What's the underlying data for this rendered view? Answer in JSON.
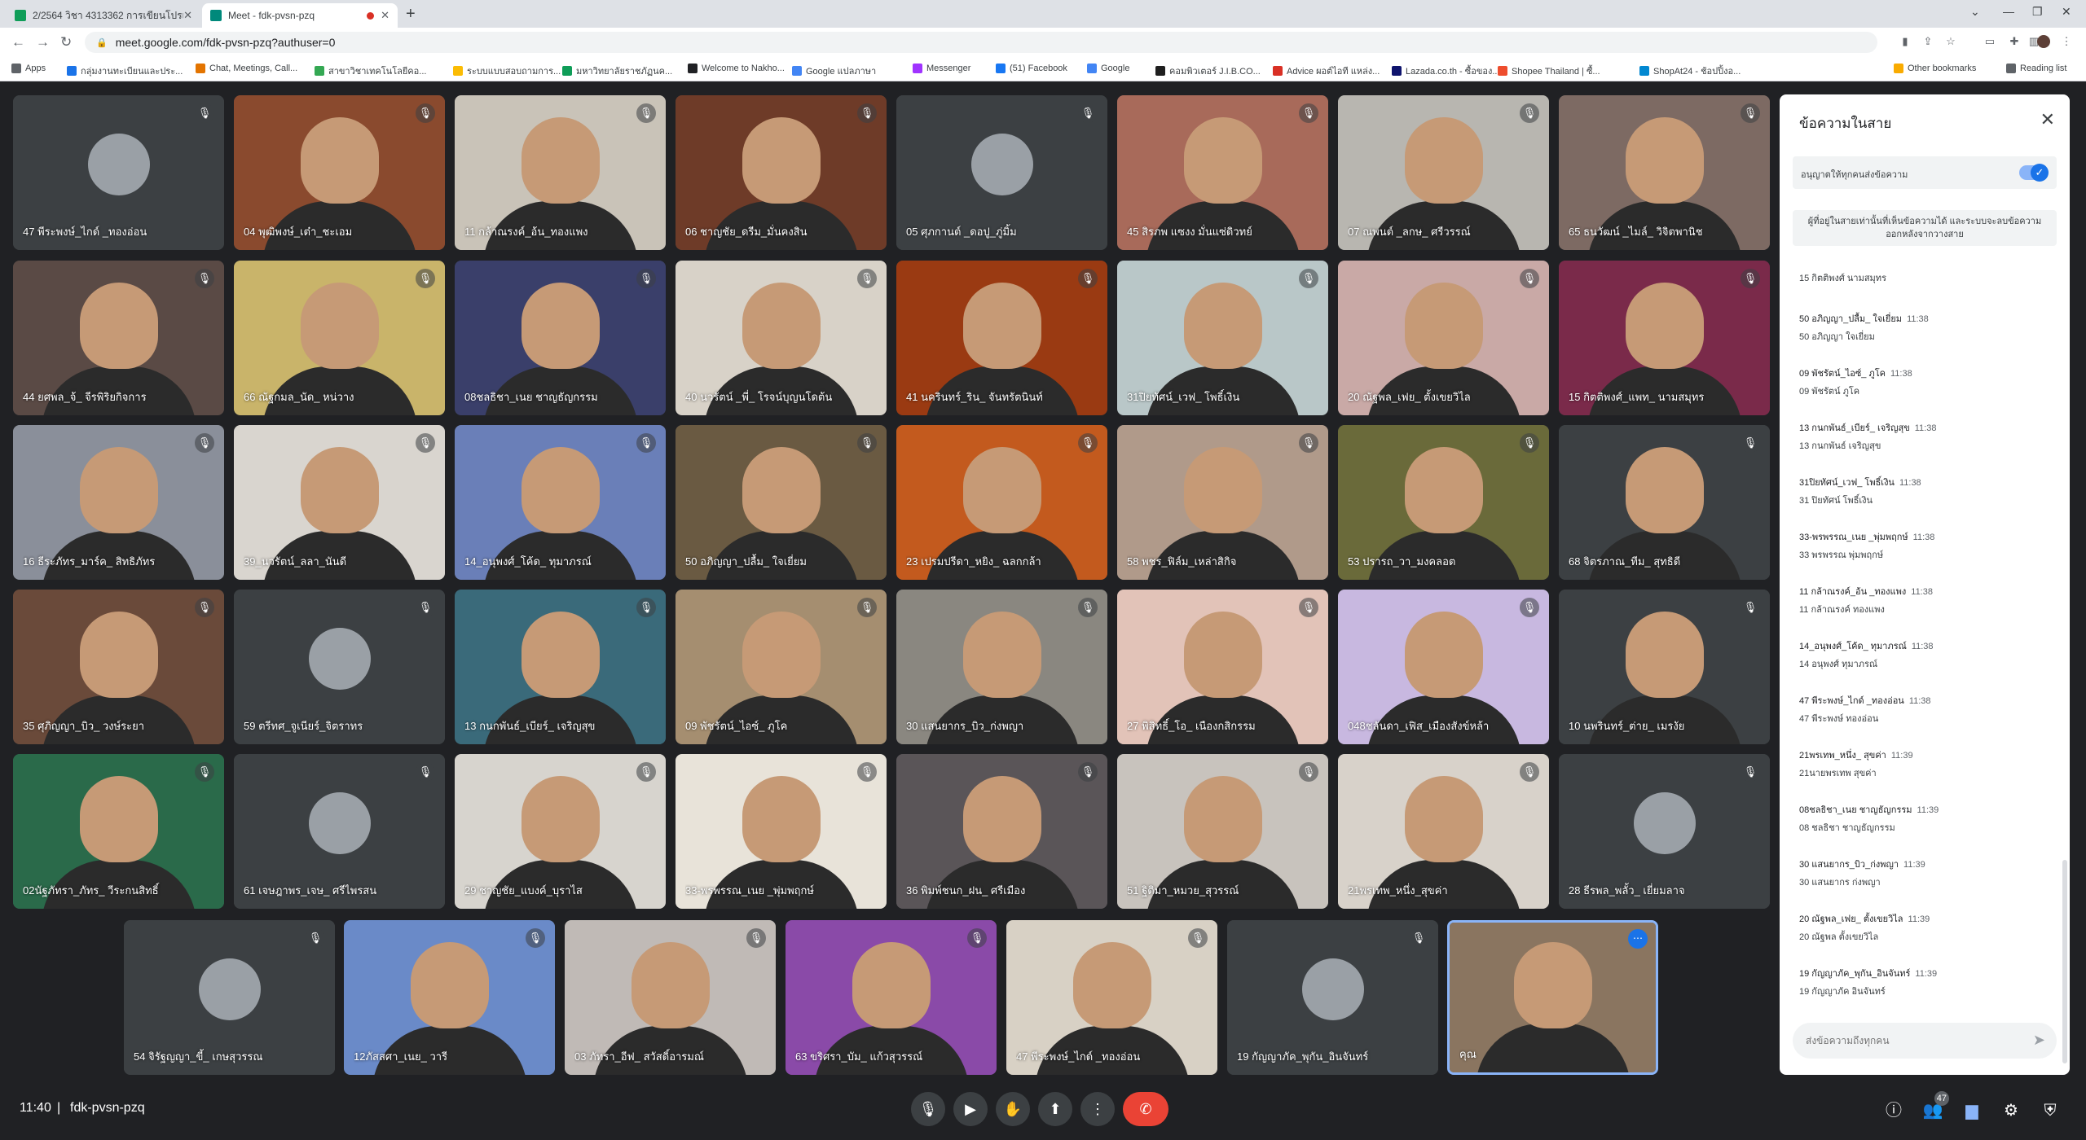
{
  "browser": {
    "tabs": [
      {
        "title": "2/2564 วิชา 4313362 การเขียนโปรแ",
        "favicon_color": "#0f9d58"
      },
      {
        "title": "Meet - fdk-pvsn-pzq",
        "favicon_color": "#00897b"
      }
    ],
    "url": "meet.google.com/fdk-pvsn-pzq?authuser=0",
    "bookmarks": [
      {
        "label": "Apps",
        "color": "#5f6368"
      },
      {
        "label": "กลุ่มงานทะเบียนและประ...",
        "color": "#1a73e8"
      },
      {
        "label": "Chat, Meetings, Call...",
        "color": "#e37400"
      },
      {
        "label": "สาขาวิชาเทคโนโลยีคอ...",
        "color": "#34a853"
      },
      {
        "label": "ระบบแบบสอบถามการ...",
        "color": "#fbbc04"
      },
      {
        "label": "มหาวิทยาลัยราชภัฏนค...",
        "color": "#0f9d58"
      },
      {
        "label": "Welcome to Nakho...",
        "color": "#202124"
      },
      {
        "label": "Google แปลภาษา",
        "color": "#4285f4"
      },
      {
        "label": "Messenger",
        "color": "#a033ff"
      },
      {
        "label": "(51) Facebook",
        "color": "#1877f2"
      },
      {
        "label": "Google",
        "color": "#4285f4"
      },
      {
        "label": "คอมพิวเตอร์ J.I.B.CO...",
        "color": "#1f1f1f"
      },
      {
        "label": "Advice ผอต์ไอที แหล่ง...",
        "color": "#d93025"
      },
      {
        "label": "Lazada.co.th - ซื้อของ...",
        "color": "#0f146d"
      },
      {
        "label": "Shopee Thailand | ซื้...",
        "color": "#ee4d2d"
      },
      {
        "label": "ShopAt24 - ช้อปปิ้งอ...",
        "color": "#0288d1"
      }
    ],
    "other_bookmarks": "Other bookmarks",
    "reading_list": "Reading list"
  },
  "participants": [
    {
      "name": "47 พีระพงษ์_ไกด์ _ทองอ่อน",
      "color": "#3c4043",
      "avatar": true
    },
    {
      "name": "04 พุฒิพงษ์_เต๋า_ชะเอม",
      "color": "#8a4a2e",
      "avatar": false
    },
    {
      "name": "11 กล้าณรงค์_อ้น_ทองแพง",
      "color": "#c9c3b8",
      "avatar": false
    },
    {
      "name": "06 ชาญชัย_ดรีม_มั่นคงสิน",
      "color": "#6e3b28",
      "avatar": false
    },
    {
      "name": "05 ศุภกานต์ _ดอปู_ภู่มิ้ม",
      "color": "#3c4043",
      "avatar": true
    },
    {
      "name": "45 สิรภพ แซงง มั่นแซ่ดิวทย์",
      "color": "#a86a5a",
      "avatar": false
    },
    {
      "name": "07 ณพนต์ _ลกษ_ ศรีวรรณ์",
      "color": "#b8b6b0",
      "avatar": false
    },
    {
      "name": "65 ธนวัฒน์ _ไมล์_ วิจิตพานิช",
      "color": "#7d6a63",
      "avatar": false
    },
    {
      "name": "44 ยศพล_จ้_ จีรพิริยกิจการ",
      "color": "#5a4a45",
      "avatar": false
    },
    {
      "name": "66 ณัฐกมล_นัด_ หน่วาง",
      "color": "#c9b46a",
      "avatar": false
    },
    {
      "name": "08ชลธิชา_เนย ชาญธัญกรรม",
      "color": "#3a3f6a",
      "avatar": false
    },
    {
      "name": "40 นวรัตน์ _พี่_ โรจน์บุญนโดต้น",
      "color": "#d8d2c8",
      "avatar": false
    },
    {
      "name": "41 นครินทร์_ริน_ จันทรัตนินท์",
      "color": "#9a3a12",
      "avatar": false
    },
    {
      "name": "31ปิยทัศน์_เวฟ_ โพธิ์เงิน",
      "color": "#b9c7c8",
      "avatar": false
    },
    {
      "name": "20 ณัฐพล_เฟย_ ตั้งเขยวิไล",
      "color": "#c9a9a6",
      "avatar": false
    },
    {
      "name": "15 กิตติพงศ์_แพท_ นามสมุทร",
      "color": "#7a2a4a",
      "avatar": false
    },
    {
      "name": "16 ธีระภัทร_มาร์ค_ สิทธิภัทร",
      "color": "#8a8f9a",
      "avatar": false
    },
    {
      "name": "39_นวรัตน์_ลลา_นันดี",
      "color": "#d9d5cf",
      "avatar": false
    },
    {
      "name": "14_อนุพงศ์_โค้ด_ ทุมาภรณ์",
      "color": "#6a7fb8",
      "avatar": false
    },
    {
      "name": "50 อภิญญา_ปลื้ม_ ใจเยี่ยม",
      "color": "#6a5a42",
      "avatar": false
    },
    {
      "name": "23 เปรมปรีดา_หยิง_ ฉลกกล้า",
      "color": "#c35a1e",
      "avatar": false
    },
    {
      "name": "58 พชร_ฟิล์ม_เหล่าสิกิจ",
      "color": "#b09a8a",
      "avatar": false
    },
    {
      "name": "53 ปรารถ_วา_มงคลอต",
      "color": "#6a6a3a",
      "avatar": false
    },
    {
      "name": "68 จิตรภาณ_ทีม_ สุทธิดี",
      "color": "#3c4043",
      "avatar": false
    },
    {
      "name": "35 ศุภิญญา_บิว_ วงษ์ระยา",
      "color": "#6a4a3a",
      "avatar": false
    },
    {
      "name": "59 ตรีทศ_จูเนียร์_จิตราทร",
      "color": "#3c4043",
      "avatar": true
    },
    {
      "name": "13 กนกพันธ์_เบียร์_ เจริญสุข",
      "color": "#3a6a7a",
      "avatar": false
    },
    {
      "name": "09 พัชรัตน์_ไอซ์_ ภูโค",
      "color": "#a58e70",
      "avatar": false
    },
    {
      "name": "30 แสนยากร_บิว_ก่งพญา",
      "color": "#8a8780",
      "avatar": false
    },
    {
      "name": "27 พิสิทธิ์_โอ_ เนืองกสิกรรม",
      "color": "#e2c3b8",
      "avatar": false
    },
    {
      "name": "048ชลันดา_เฟิส_เมืองสังข์หล้า",
      "color": "#c8b8e0",
      "avatar": false
    },
    {
      "name": "10 นพรินทร์_ต่าย_ เมรงัย",
      "color": "#3c4043",
      "avatar": false
    },
    {
      "name": "02นัฐภัทรา_ภัทร_ วีระกนสิทธิ์",
      "color": "#2a6a4a",
      "avatar": false
    },
    {
      "name": "61 เจษฎาพร_เจษ_ ศรีไพรสน",
      "color": "#3c4043",
      "avatar": true
    },
    {
      "name": "29 ชาญชัย_แบงค์_บุราไส",
      "color": "#d7d4ce",
      "avatar": false
    },
    {
      "name": "33-พรพรรณ_เนย _พุ่มพฤกษ์",
      "color": "#e8e3d9",
      "avatar": false
    },
    {
      "name": "36 พิมพ์ชนก_ฝน_ ศรีเมือง",
      "color": "#5a5558",
      "avatar": false
    },
    {
      "name": "51 ฐิติมา_หมวย_สุวรรณ์",
      "color": "#c8c3bd",
      "avatar": false
    },
    {
      "name": "21พรเทพ_หนึ่ง_สุขค่า",
      "color": "#d8d2ca",
      "avatar": false
    },
    {
      "name": "28 ธีรพล_พลั้ว_ เยี่ยมลาจ",
      "color": "#3c4043",
      "avatar": true
    },
    {
      "name": "54 จิรัฐญญา_ขี้_ เกษสุวรรณ",
      "color": "#3c4043",
      "avatar": true
    },
    {
      "name": "12ภัสสศา_เนย_ วารี",
      "color": "#6a8ac8",
      "avatar": false
    },
    {
      "name": "03 ภัทรา_อีฟ_ สวัสดิ์อารมณ์",
      "color": "#c0bab6",
      "avatar": false
    },
    {
      "name": "63 ขริศรา_บัม_ แก้วสุวรรณ์",
      "color": "#8a4aa8",
      "avatar": false
    },
    {
      "name": "47 พีระพงษ์_ไกด์ _ทองอ่อน",
      "color": "#d8d1c5",
      "avatar": false
    },
    {
      "name": "19 กัญญาภัค_พุกัน_อินจันทร์",
      "color": "#3c4043",
      "avatar": true
    },
    {
      "name": "คุณ",
      "color": "#8a7560",
      "avatar": false
    }
  ],
  "chat": {
    "title": "ข้อความในสาย",
    "allow_label": "อนุญาตให้ทุกคนส่งข้อความ",
    "notice": "ผู้ที่อยู่ในสายเท่านั้นที่เห็นข้อความได้ และระบบจะลบข้อความออกหลังจากวางสาย",
    "messages": [
      {
        "sender": "",
        "time": "",
        "text": "15 กิตติพงศ์ นามสมุทร"
      },
      {
        "sender": "50 อภิญญา_ปลื้ม_ ใจเยี่ยม",
        "time": "11:38",
        "text": "50 อภิญญา ใจเยี่ยม"
      },
      {
        "sender": "09 พัชรัตน์_ไอซ์_ ภูโค",
        "time": "11:38",
        "text": "09 พัชรัตน์ ภูโค"
      },
      {
        "sender": "13 กนกพันธ์_เบียร์_ เจริญสุข",
        "time": "11:38",
        "text": "13 กนกพันธ์ เจริญสุข"
      },
      {
        "sender": "31ปิยทัศน์_เวฟ_ โพธิ์เงิน",
        "time": "11:38",
        "text": "31 ปิยทัศน์ โพธิ์เงิน"
      },
      {
        "sender": "33-พรพรรณ_เนย _พุ่มพฤกษ์",
        "time": "11:38",
        "text": "33 พรพรรณ พุ่มพฤกษ์"
      },
      {
        "sender": "11 กล้าณรงค์_อ้น _ทองแพง",
        "time": "11:38",
        "text": "11 กล้าณรงค์ ทองแพง"
      },
      {
        "sender": "14_อนุพงศ์_โค้ด_ ทุมาภรณ์",
        "time": "11:38",
        "text": "14 อนุพงศ์ ทุมาภรณ์"
      },
      {
        "sender": "47 พีระพงษ์_ไกด์ _ทองอ่อน",
        "time": "11:38",
        "text": "47 พีระพงษ์ ทองอ่อน"
      },
      {
        "sender": "21พรเทพ_หนึ่ง_ สุขค่า",
        "time": "11:39",
        "text": "21นายพรเทพ สุขค่า"
      },
      {
        "sender": "08ชลธิชา_เนย ชาญธัญกรรม",
        "time": "11:39",
        "text": "08 ชลธิชา ชาญธัญกรรม"
      },
      {
        "sender": "30 แสนยากร_บิว_ก่งพญา",
        "time": "11:39",
        "text": "30 แสนยากร ก่งพญา"
      },
      {
        "sender": "20 ณัฐพล_เฟย_ ตั้งเขยวิไล",
        "time": "11:39",
        "text": "20 ณัฐพล ตั้งเขยวิไล"
      },
      {
        "sender": "19 กัญญาภัค_พุกัน_อินจันทร์",
        "time": "11:39",
        "text": "19 กัญญาภัค อินจันทร์"
      }
    ],
    "input_placeholder": "ส่งข้อความถึงทุกคน"
  },
  "meeting": {
    "time": "11:40",
    "separator": "|",
    "code": "fdk-pvsn-pzq",
    "participant_count": "47"
  },
  "icons": {
    "mic_off": "🎙",
    "close": "✕",
    "check": "✓",
    "send": "➤",
    "more": "⋯"
  },
  "colors": {
    "meet_bg": "#202124",
    "end_call": "#ea4335",
    "accent": "#1a73e8"
  }
}
